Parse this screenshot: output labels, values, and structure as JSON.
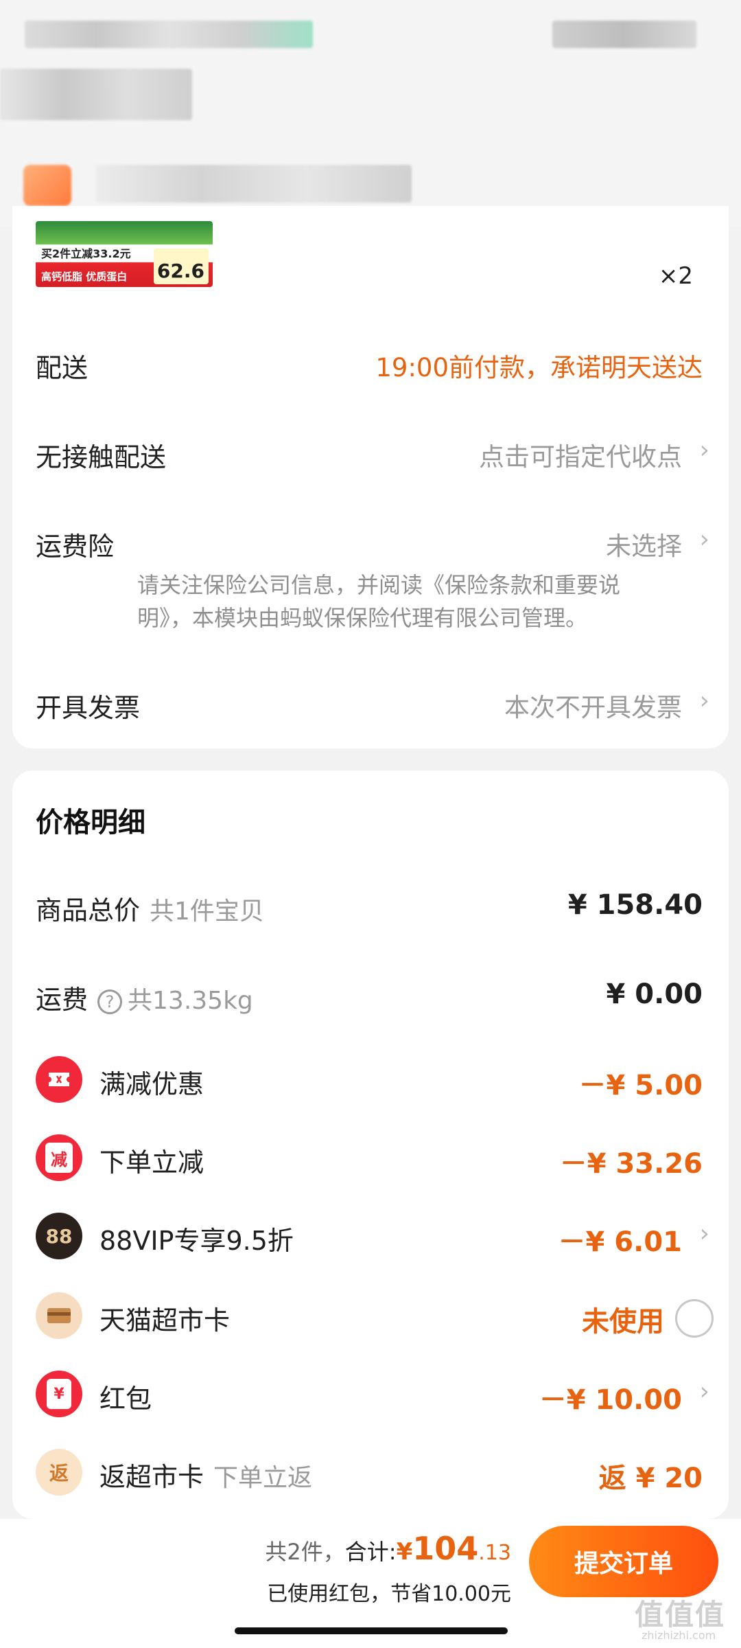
{
  "product": {
    "thumb_line1": "买2件立减33.2元",
    "thumb_line2": "高钙低脂 优质蛋白",
    "thumb_price": "62.6",
    "quantity": "×2"
  },
  "order_options": [
    {
      "label": "配送",
      "value": "19:00前付款，承诺明天送达"
    },
    {
      "label": "无接触配送",
      "value": "点击可指定代收点"
    },
    {
      "label": "运费险",
      "value": "未选择"
    },
    {
      "label": "开具发票",
      "value": "本次不开具发票"
    }
  ],
  "insurance_note": "请关注保险公司信息，并阅读《保险条款和重要说明》，本模块由蚂蚁保保险代理有限公司管理。",
  "price_detail": {
    "title": "价格明细",
    "goods_total": {
      "label": "商品总价",
      "sub": "共1件宝贝",
      "amount": "¥ 158.40"
    },
    "shipping": {
      "label": "运费",
      "sub": "共13.35kg",
      "amount": "¥ 0.00"
    },
    "discounts": [
      {
        "label": "满减优惠",
        "amount": "－¥ 5.00",
        "icon": "ticket-icon"
      },
      {
        "label": "下单立减",
        "amount": "－¥ 33.26",
        "icon_text": "减"
      },
      {
        "label": "88VIP专享9.5折",
        "amount": "－¥ 6.01",
        "icon_text": "88"
      },
      {
        "label": "天猫超市卡",
        "amount": "未使用",
        "icon": "card-icon"
      },
      {
        "label": "红包",
        "amount": "－¥ 10.00",
        "icon_text": "¥"
      },
      {
        "label": "返超市卡",
        "sub": "下单立返",
        "amount": "返 ¥ 20",
        "icon_text": "返"
      }
    ]
  },
  "checkout": {
    "count": "共2件，",
    "total_label": "合计:",
    "currency": "¥",
    "total_main": "104",
    "total_decimal": ".13",
    "saved_note": "已使用红包，节省10.00元",
    "submit_label": "提交订单"
  },
  "watermark": {
    "main": "值值值",
    "sub": "zhizhizhi.com"
  },
  "colors": {
    "accent": "#e8630f",
    "button_start": "#ff8a14",
    "button_end": "#ff4f0f"
  }
}
